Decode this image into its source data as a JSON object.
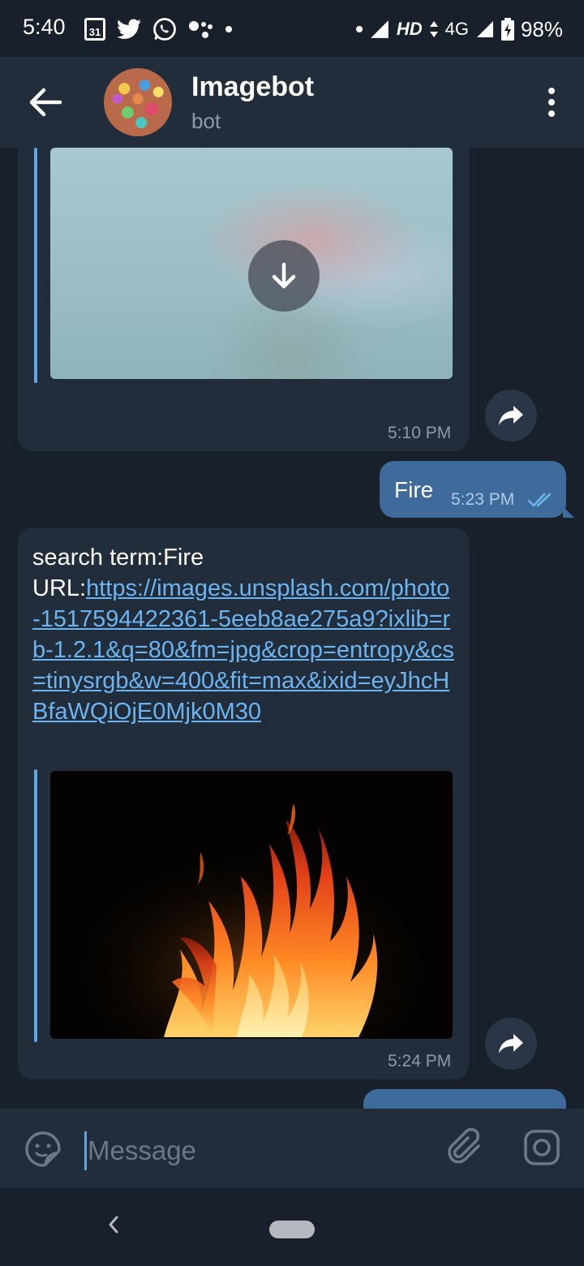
{
  "status_bar": {
    "time": "5:40",
    "calendar_day": "31",
    "network": "HD",
    "network_type": "4G",
    "battery": "98%"
  },
  "header": {
    "title": "Imagebot",
    "subtitle": "bot"
  },
  "messages": [
    {
      "direction": "incoming",
      "type": "image",
      "image_state": "blurred-preview",
      "time": "5:10 PM"
    },
    {
      "direction": "outgoing",
      "text": "Fire",
      "time": "5:23 PM",
      "status": "read"
    },
    {
      "direction": "incoming",
      "search_line": "search term:Fire",
      "url_label": "URL:",
      "url": "https://images.unsplash.com/photo-1517594422361-5eeb8ae275a9?ixlib=rb-1.2.1&q=80&fm=jpg&crop=entropy&cs=tinysrgb&w=400&fit=max&ixid=eyJhcHBfaWQiOjE0Mjk0M30",
      "image": "fire-photo",
      "time": "5:24 PM"
    }
  ],
  "composer": {
    "placeholder": "Message"
  },
  "icons": {
    "back": "arrow-left-icon",
    "menu": "more-vertical-icon",
    "download": "arrow-down-icon",
    "share": "share-icon",
    "emoji": "sticker-icon",
    "attach": "paperclip-icon",
    "camera": "instagram-camera-icon"
  },
  "colors": {
    "background": "#18202b",
    "header": "#212d3b",
    "bubble_in": "#222d3b",
    "bubble_out": "#3e6a9c",
    "link": "#6cb4f0",
    "accent": "#5fa8e6"
  }
}
